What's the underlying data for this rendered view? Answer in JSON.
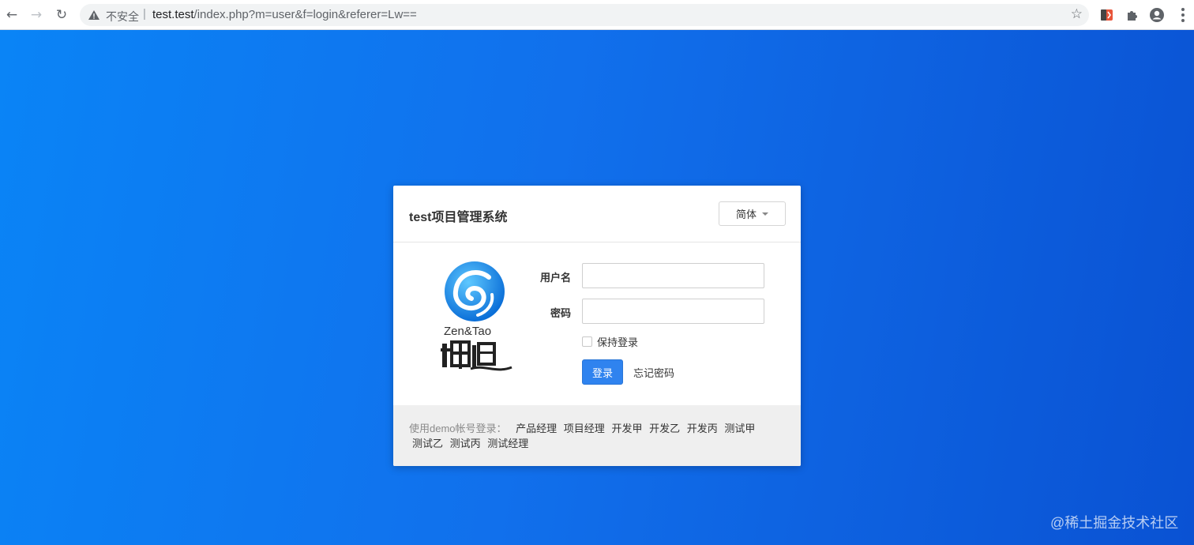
{
  "browser": {
    "insecure_label": "不安全",
    "separator": "|",
    "url_host": "test.test",
    "url_path": "/index.php?m=user&f=login&referer=Lw=="
  },
  "login": {
    "title": "test项目管理系统",
    "language": "简体",
    "username_label": "用户名",
    "username_value": "",
    "password_label": "密码",
    "password_value": "",
    "remember_label": "保持登录",
    "remember_checked": false,
    "submit_label": "登录",
    "forgot_label": "忘记密码",
    "logo_brand": "Zen&Tao"
  },
  "demo": {
    "label": "使用demo帐号登录：",
    "accounts": [
      "产品经理",
      "项目经理",
      "开发甲",
      "开发乙",
      "开发丙",
      "测试甲",
      "测试乙",
      "测试丙",
      "测试经理"
    ]
  },
  "watermark": "@稀土掘金技术社区",
  "colors": {
    "background_start": "#0a84f6",
    "background_end": "#0a52d3",
    "primary_button": "#2f83ef",
    "logo_blue": "#1b8de8"
  }
}
